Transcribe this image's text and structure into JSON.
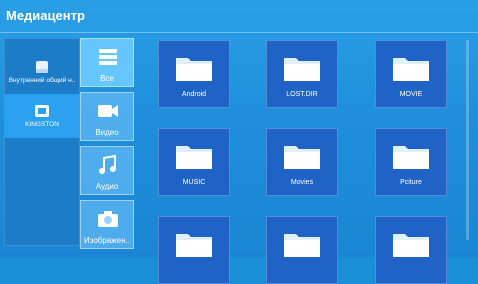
{
  "app": {
    "title": "Медиацентр"
  },
  "devices": [
    {
      "label": "Внутренний общий н..",
      "icon": "storage-icon"
    },
    {
      "label": "KINGSTON",
      "icon": "usb-drive-icon",
      "selected": true
    }
  ],
  "categories": [
    {
      "label": "Все",
      "icon": "all-files-icon",
      "active": true
    },
    {
      "label": "Видео",
      "icon": "video-icon"
    },
    {
      "label": "Аудио",
      "icon": "music-icon"
    },
    {
      "label": "Изображен..",
      "icon": "camera-icon"
    }
  ],
  "folders": [
    {
      "label": "Android"
    },
    {
      "label": "LOST.DIR"
    },
    {
      "label": "MOVIE"
    },
    {
      "label": "MUSIC"
    },
    {
      "label": "Movies"
    },
    {
      "label": "Pciture"
    },
    {
      "label": ""
    },
    {
      "label": ""
    },
    {
      "label": ""
    }
  ],
  "colors": {
    "background": "#1f8fdb",
    "tile": "#1f63c6",
    "accent": "#66c6ff"
  }
}
